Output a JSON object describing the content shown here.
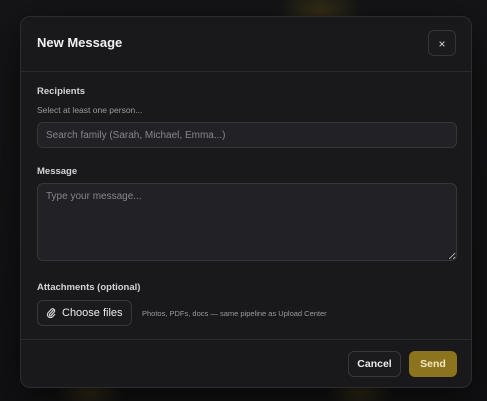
{
  "dialog": {
    "title": "New Message",
    "close_label": "×"
  },
  "recipients": {
    "label": "Recipients",
    "hint": "Select at least one person...",
    "placeholder": "Search family (Sarah, Michael, Emma...)"
  },
  "message": {
    "label": "Message",
    "placeholder": "Type your message..."
  },
  "attachments": {
    "label": "Attachments (optional)",
    "button_label": "Choose files",
    "button_icon": "paperclip-icon",
    "note": "Photos, PDFs, docs — same pipeline as Upload Center"
  },
  "footer": {
    "cancel_label": "Cancel",
    "send_label": "Send"
  },
  "colors": {
    "accent": "#8c741f",
    "background": "#19191c"
  }
}
